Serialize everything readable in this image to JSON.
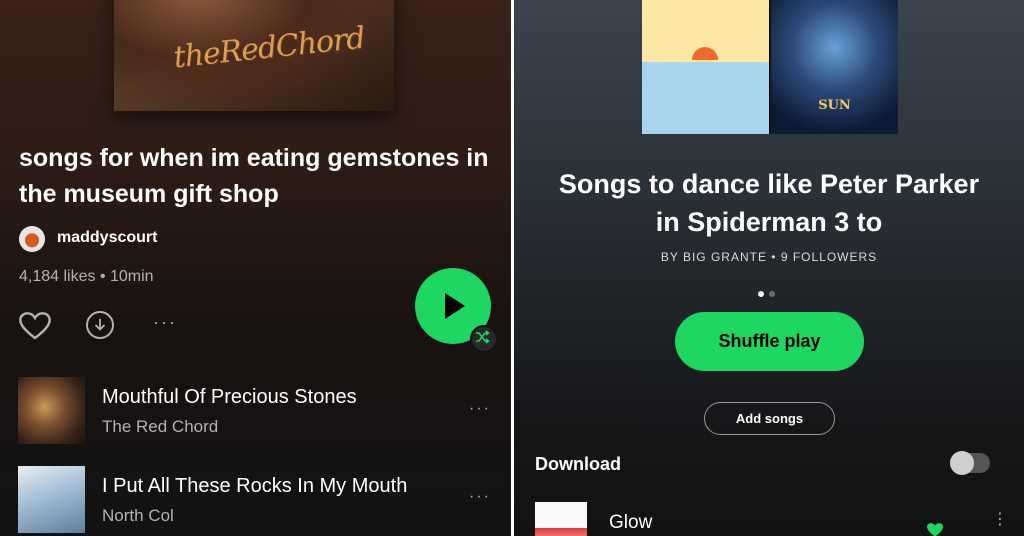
{
  "left_panel": {
    "cover_art": {
      "text": "theRedChord"
    },
    "playlist_title": "songs for when im eating gemstones in the museum gift shop",
    "owner_name": "maddyscourt",
    "meta": "4,184 likes • 10min",
    "actions": {
      "more": "···"
    },
    "tracks": [
      {
        "title": "Mouthful Of Precious Stones",
        "artist": "The Red Chord",
        "more": "···"
      },
      {
        "title": "I Put All These Rocks In My Mouth",
        "artist": "North Col",
        "more": "···"
      }
    ],
    "colors": {
      "play_button": "#1ed760",
      "background_top": "#3a2218"
    }
  },
  "right_panel": {
    "cover_art": {
      "tile_b_text": "SUN"
    },
    "playlist_title": "Songs to dance like Peter Parker in Spiderman 3 to",
    "owner_meta": "BY BIG GRANTE • 9 FOLLOWERS",
    "shuffle_button": "Shuffle play",
    "add_songs_button": "Add songs",
    "download_label": "Download",
    "download_enabled": false,
    "tracks": [
      {
        "title": "Glow",
        "liked": true,
        "more": "⋮"
      }
    ],
    "colors": {
      "accent": "#1ed760",
      "background_top": "#3b4450"
    }
  }
}
